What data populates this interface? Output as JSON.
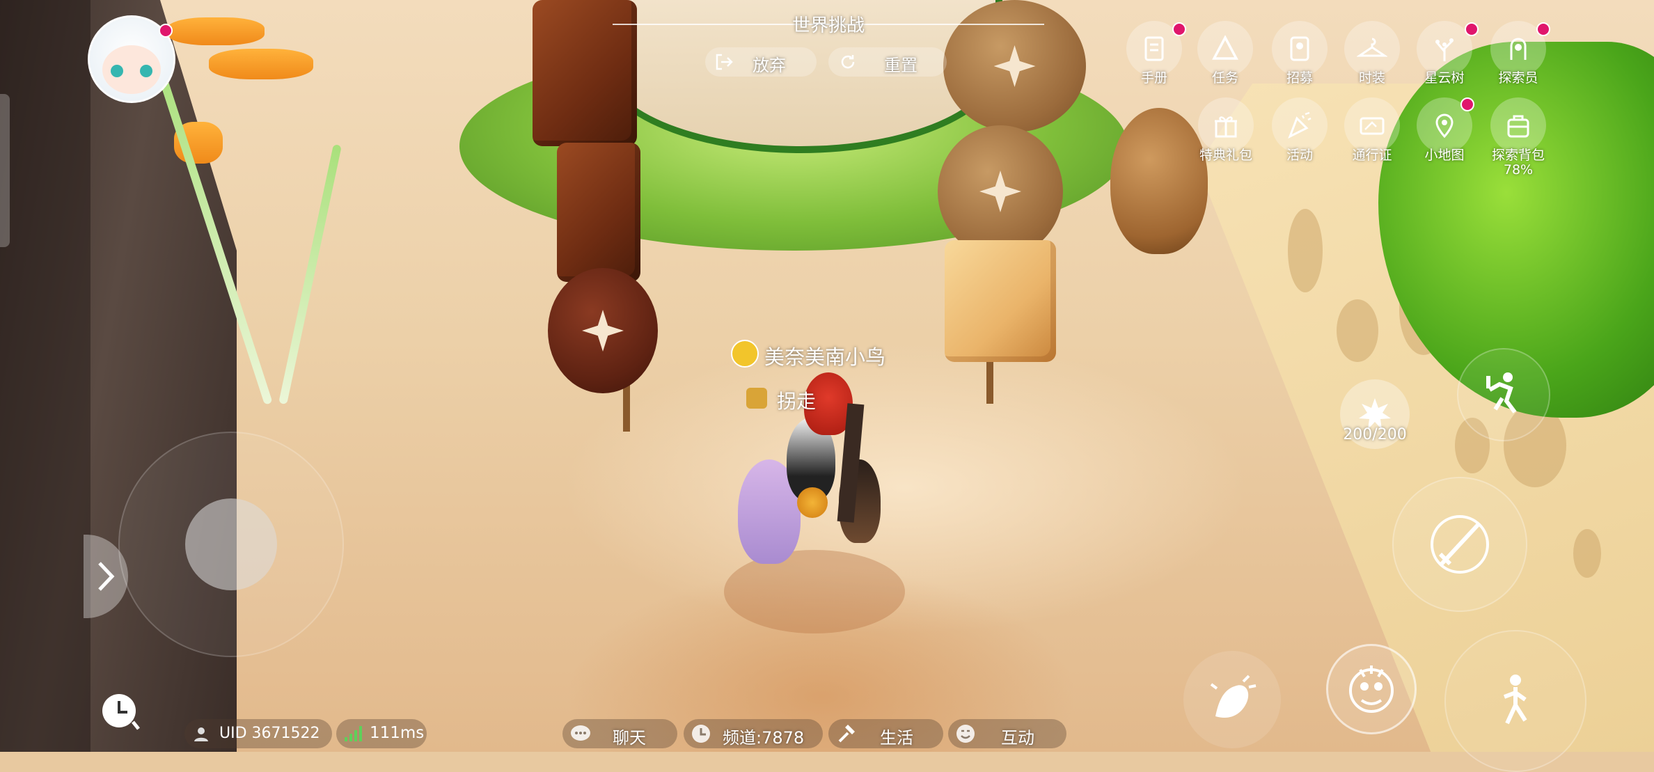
{
  "top_banner": {
    "title": "世界挑战",
    "abandon_label": "放弃",
    "reset_label": "重置"
  },
  "player": {
    "name": "美奈美南小鸟",
    "title": "拐走"
  },
  "menu_row1": [
    {
      "id": "handbook",
      "label": "手册",
      "icon": "book-icon",
      "badge": true
    },
    {
      "id": "quest",
      "label": "任务",
      "icon": "triangle-icon",
      "badge": false
    },
    {
      "id": "recruit",
      "label": "招募",
      "icon": "card-icon",
      "badge": false
    },
    {
      "id": "fashion",
      "label": "时装",
      "icon": "hanger-icon",
      "badge": false
    },
    {
      "id": "star-tree",
      "label": "星云树",
      "icon": "tree-icon",
      "badge": true
    },
    {
      "id": "explorer",
      "label": "探索员",
      "icon": "portrait-icon",
      "badge": true
    }
  ],
  "menu_row2": [
    {
      "id": "gift",
      "label": "特典礼包",
      "icon": "gift-icon",
      "badge": false
    },
    {
      "id": "event",
      "label": "活动",
      "icon": "party-icon",
      "badge": false
    },
    {
      "id": "pass",
      "label": "通行证",
      "icon": "ticket-icon",
      "badge": false
    },
    {
      "id": "minimap",
      "label": "小地图",
      "icon": "map-pin-icon",
      "badge": true
    },
    {
      "id": "backpack",
      "label": "探索背包",
      "sub": "78%",
      "icon": "backpack-icon",
      "badge": false
    }
  ],
  "skill": {
    "energy": "200/200"
  },
  "bottom_bar": {
    "uid": "UID 3671522",
    "ping": "111ms",
    "chat": "聊天",
    "channel": "频道:7878",
    "life": "生活",
    "interact": "互动"
  },
  "colors": {
    "badge": "#e0166c",
    "ping_green": "#5fd05a"
  }
}
